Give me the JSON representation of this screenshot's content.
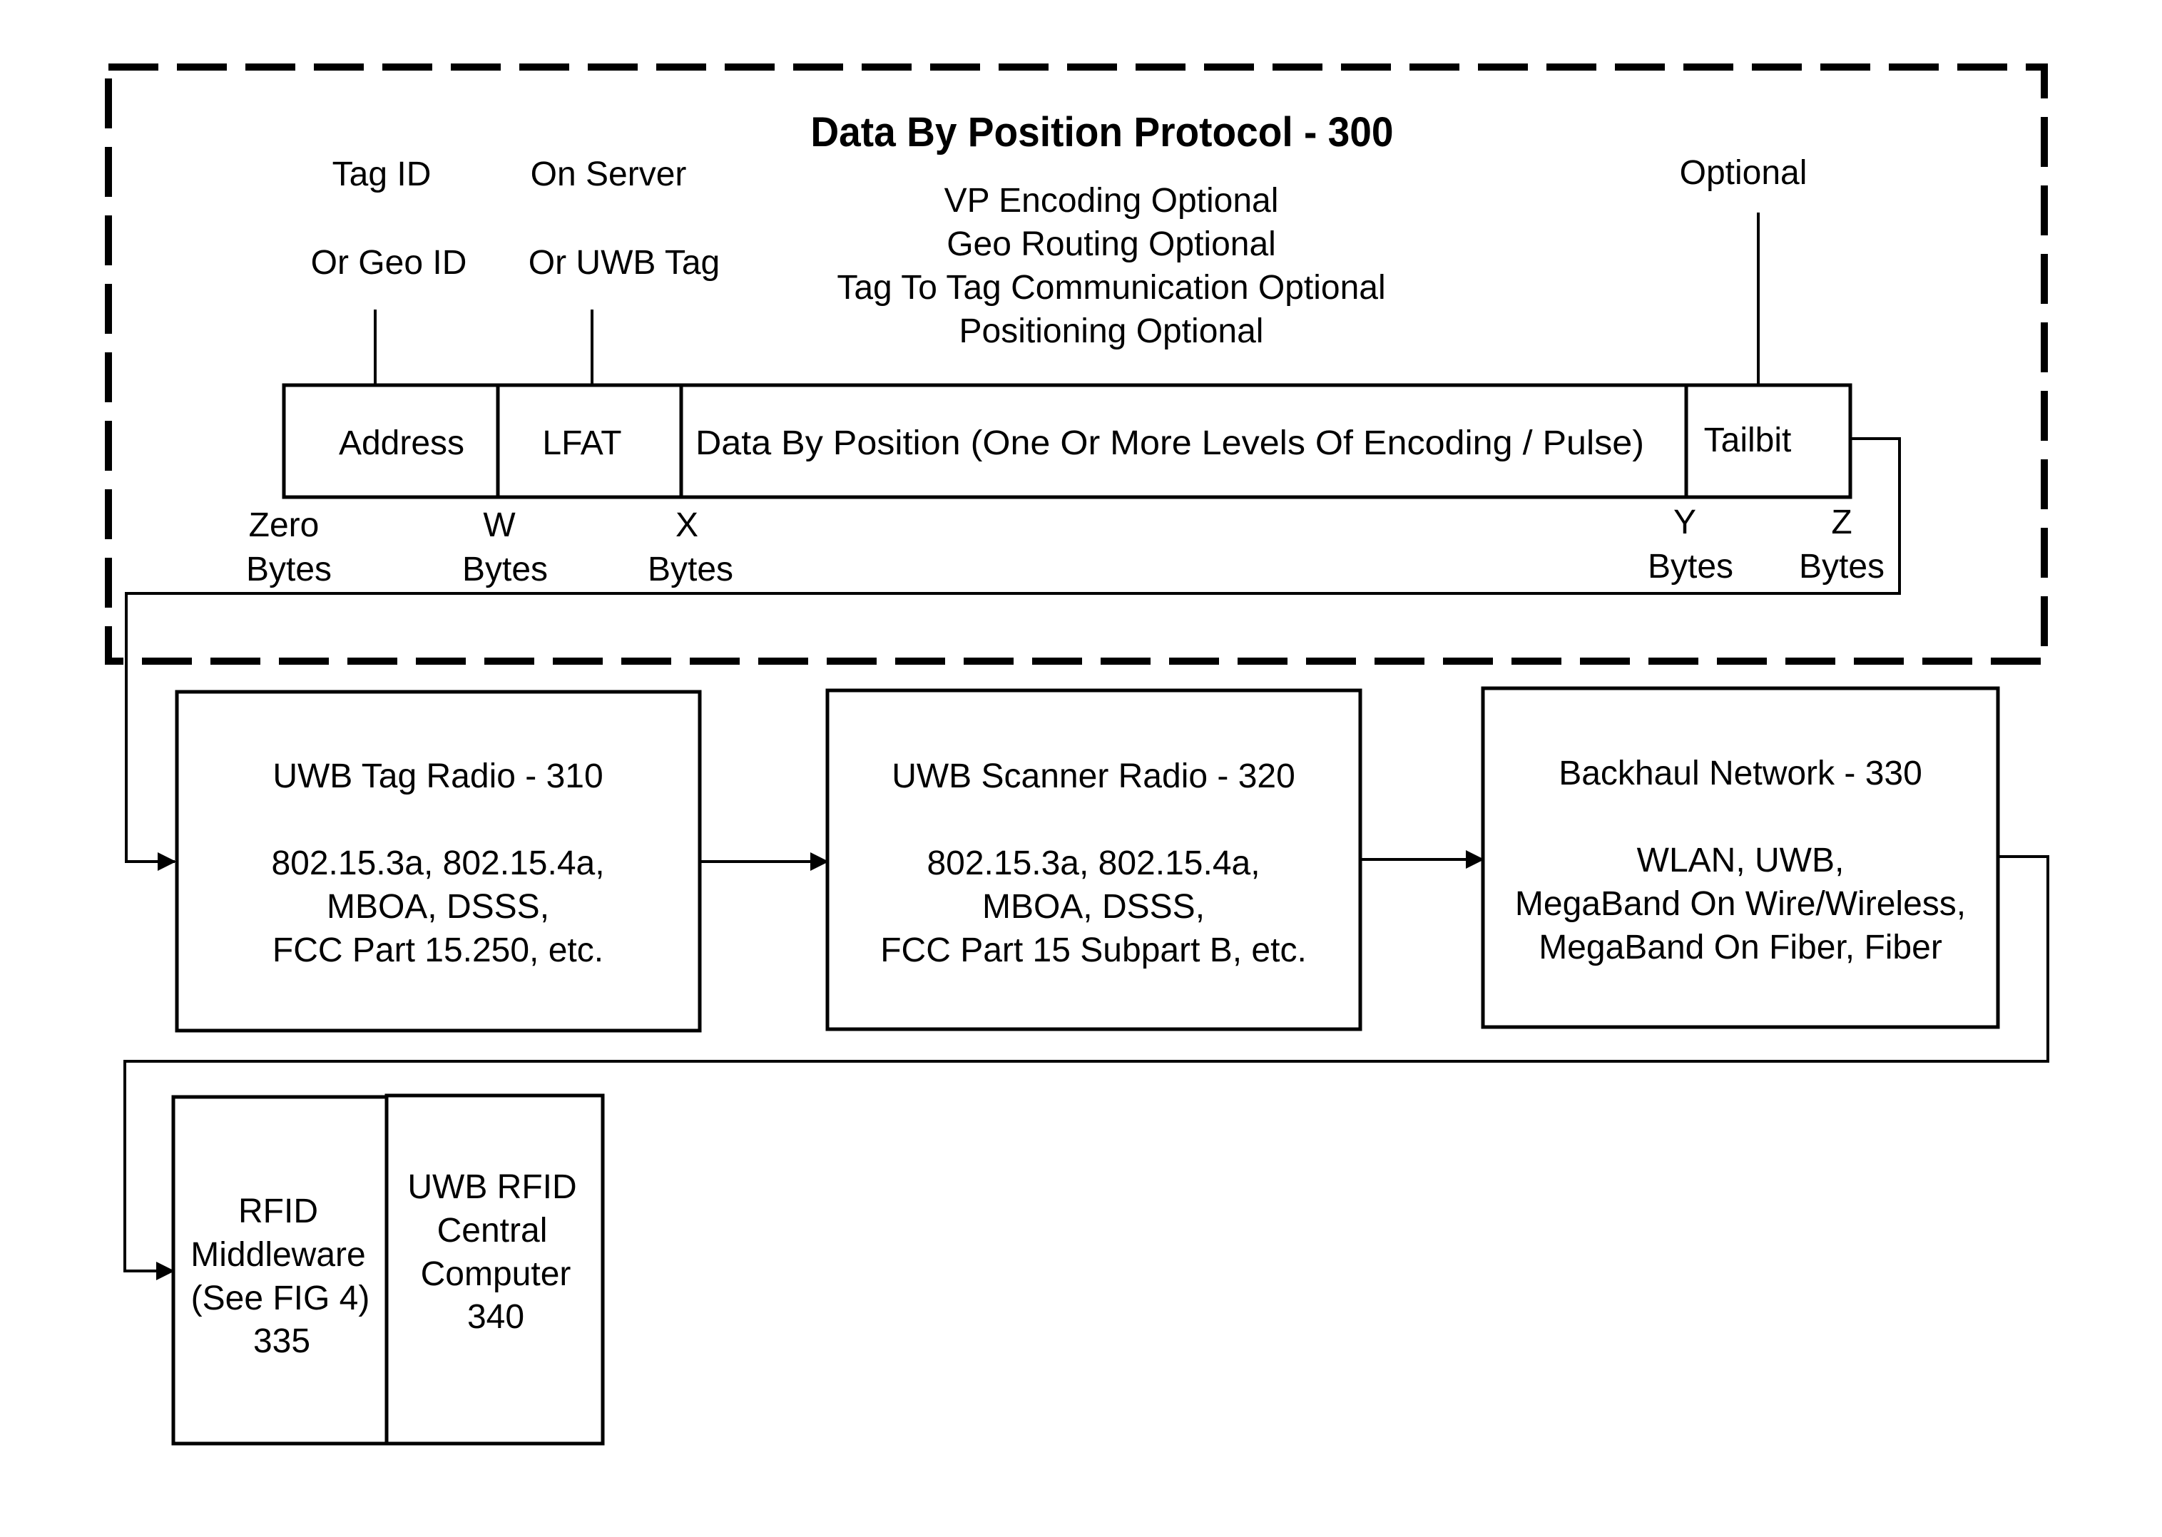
{
  "figure": {
    "title": "Data By Position Protocol - 300",
    "address_annotation": [
      "Tag ID",
      "Or Geo ID"
    ],
    "lfat_annotation": [
      "On Server",
      "Or UWB Tag"
    ],
    "data_annotation": [
      "VP Encoding Optional",
      "Geo Routing Optional",
      "Tag To Tag Communication Optional",
      "Positioning Optional"
    ],
    "tailbit_annotation": "Optional",
    "packet_fields": [
      {
        "label": "Address"
      },
      {
        "label": "LFAT"
      },
      {
        "label": "Data By Position (One Or More Levels Of Encoding / Pulse)"
      },
      {
        "label": "Tailbit"
      }
    ],
    "byte_markers": [
      {
        "top": "Zero",
        "bottom": "Bytes"
      },
      {
        "top": "W",
        "bottom": "Bytes"
      },
      {
        "top": "X",
        "bottom": "Bytes"
      },
      {
        "top": "Y",
        "bottom": "Bytes"
      },
      {
        "top": "Z",
        "bottom": "Bytes"
      }
    ],
    "blocks": [
      {
        "id": "310",
        "title": "UWB Tag Radio - 310",
        "lines": [
          "802.15.3a, 802.15.4a,",
          "MBOA, DSSS,",
          "FCC Part 15.250, etc."
        ]
      },
      {
        "id": "320",
        "title": "UWB Scanner Radio - 320",
        "lines": [
          "802.15.3a, 802.15.4a,",
          "MBOA, DSSS,",
          "FCC Part 15 Subpart B, etc."
        ]
      },
      {
        "id": "330",
        "title": "Backhaul Network - 330",
        "lines": [
          "WLAN, UWB,",
          "MegaBand On Wire/Wireless,",
          "MegaBand On Fiber, Fiber"
        ]
      }
    ],
    "middleware": {
      "lines": [
        "RFID",
        "Middleware",
        "(See FIG 4)",
        "335"
      ]
    },
    "central_computer": {
      "lines": [
        "UWB RFID",
        "Central",
        "Computer",
        "340"
      ]
    }
  }
}
